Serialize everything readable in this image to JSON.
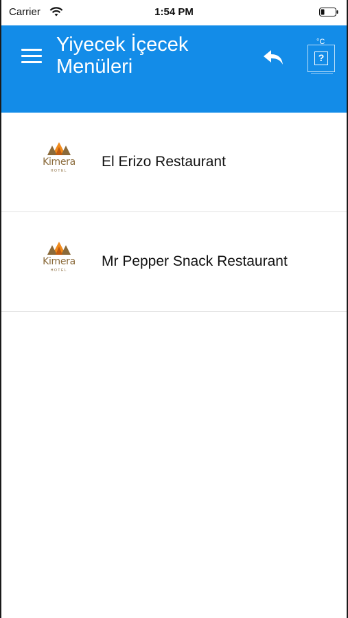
{
  "status_bar": {
    "carrier": "Carrier",
    "time": "1:54 PM",
    "wifi_icon": "wifi-icon",
    "battery_icon": "battery-icon"
  },
  "header": {
    "menu_icon": "hamburger-menu-icon",
    "title": "Yiyecek İçecek Menüleri",
    "back_icon": "reply-arrow-icon",
    "unit_label": "°C",
    "help_glyph": "?",
    "background_color": "#138ce8"
  },
  "restaurants": [
    {
      "name": "El Erizo Restaurant",
      "logo_text": "Kimera",
      "logo_subtext": "HOTEL"
    },
    {
      "name": "Mr Pepper Snack Restaurant",
      "logo_text": "Kimera",
      "logo_subtext": "HOTEL"
    }
  ],
  "colors": {
    "accent": "#138ce8",
    "logo_orange": "#f08a1c",
    "logo_brown": "#8a6a3a"
  }
}
